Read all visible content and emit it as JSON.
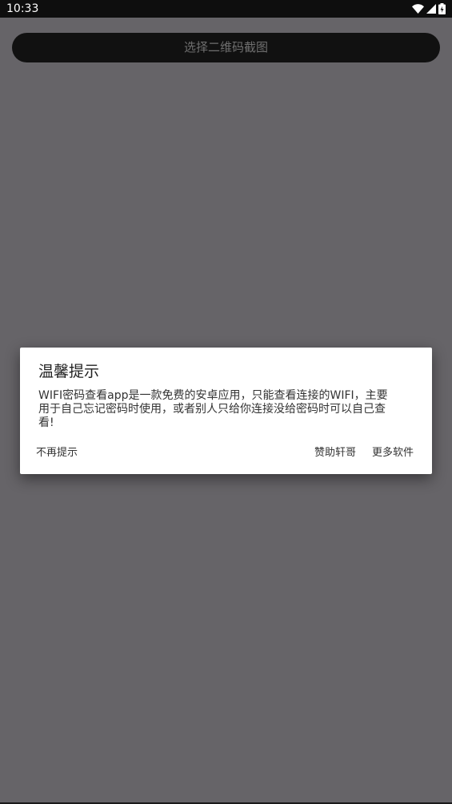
{
  "status_bar": {
    "time": "10:33",
    "icons": [
      "wifi-icon",
      "cellular-signal-icon",
      "battery-icon"
    ]
  },
  "main": {
    "select_button_label": "选择二维码截图"
  },
  "dialog": {
    "title": "温馨提示",
    "message": "WIFI密码查看app是一款免费的安卓应用，只能查看连接的WIFI，主要\n用于自己忘记密码时使用，或者别人只给你连接没给密码时可以自己查\n看!",
    "buttons": {
      "neutral": "不再提示",
      "sponsor": "赞助轩哥",
      "more": "更多软件"
    }
  },
  "colors": {
    "background": "#666468",
    "status_bar": "#0e0e0e",
    "button_bg": "#111111",
    "button_text": "#6f6f6f",
    "dialog_bg": "#ffffff"
  }
}
